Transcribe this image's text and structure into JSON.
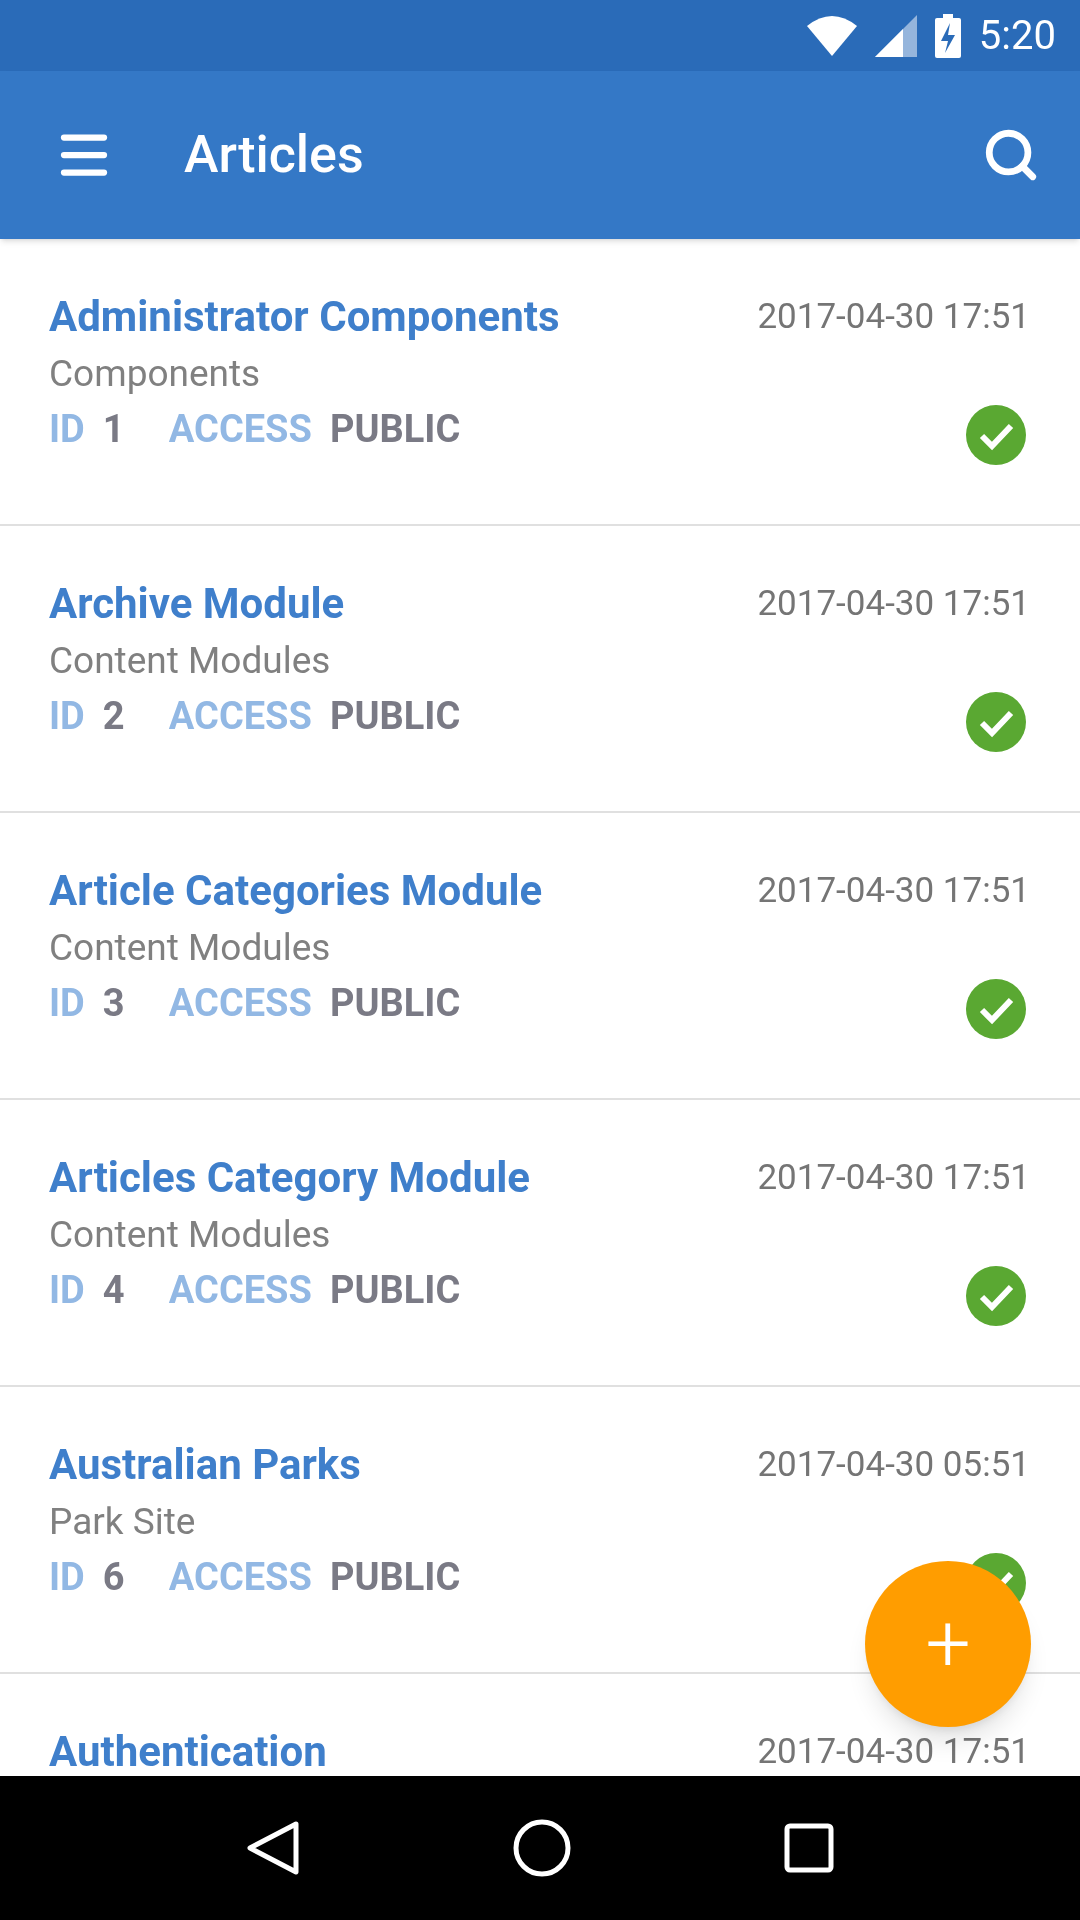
{
  "status_bar": {
    "time": "5:20"
  },
  "app_bar": {
    "title": "Articles"
  },
  "articles": [
    {
      "title": "Administrator Components",
      "category": "Components",
      "id_label": "ID",
      "id": "1",
      "access_label": "ACCESS",
      "access": "PUBLIC",
      "date": "2017-04-30 17:51",
      "published": true
    },
    {
      "title": "Archive Module",
      "category": "Content Modules",
      "id_label": "ID",
      "id": "2",
      "access_label": "ACCESS",
      "access": "PUBLIC",
      "date": "2017-04-30 17:51",
      "published": true
    },
    {
      "title": "Article Categories Module",
      "category": "Content Modules",
      "id_label": "ID",
      "id": "3",
      "access_label": "ACCESS",
      "access": "PUBLIC",
      "date": "2017-04-30 17:51",
      "published": true
    },
    {
      "title": "Articles Category Module",
      "category": "Content Modules",
      "id_label": "ID",
      "id": "4",
      "access_label": "ACCESS",
      "access": "PUBLIC",
      "date": "2017-04-30 17:51",
      "published": true
    },
    {
      "title": "Australian Parks",
      "category": "Park Site",
      "id_label": "ID",
      "id": "6",
      "access_label": "ACCESS",
      "access": "PUBLIC",
      "date": "2017-04-30 05:51",
      "published": true
    },
    {
      "title": "Authentication",
      "date": "2017-04-30 17:51"
    }
  ],
  "fab": {
    "label": "+"
  }
}
